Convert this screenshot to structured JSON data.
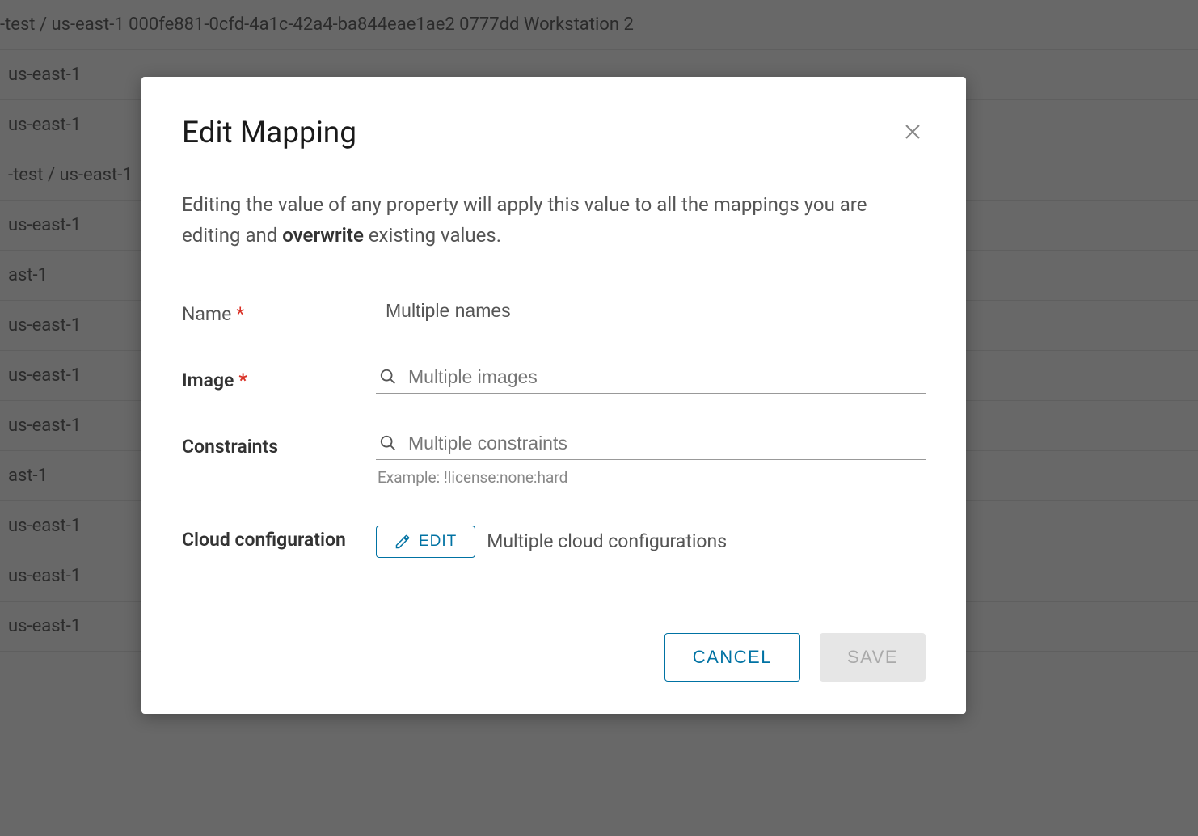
{
  "background": {
    "rows": [
      "-test / us-east-1          000fe881-0cfd-4a1c-42a4-ba844eae1ae2 0777dd Workstation 2",
      "us-east-1",
      "us-east-1",
      "-test / us-east-1",
      "us-east-1",
      "ast-1",
      "us-east-1",
      "us-east-1",
      "us-east-1",
      "ast-1",
      "us-east-1",
      "us-east-1",
      "us-east-1"
    ]
  },
  "modal": {
    "title": "Edit Mapping",
    "description_part1": "Editing the value of any property will apply this value to all the mappings you are editing and ",
    "description_bold": "overwrite",
    "description_part2": " existing values.",
    "fields": {
      "name": {
        "label": "Name",
        "required": true,
        "value": "Multiple names"
      },
      "image": {
        "label": "Image",
        "required": true,
        "placeholder": "Multiple images"
      },
      "constraints": {
        "label": "Constraints",
        "required": false,
        "placeholder": "Multiple constraints",
        "helper": "Example: !license:none:hard"
      },
      "cloud_config": {
        "label": "Cloud configuration",
        "edit_button": "EDIT",
        "value_text": "Multiple cloud configurations"
      }
    },
    "buttons": {
      "cancel": "CANCEL",
      "save": "SAVE"
    }
  }
}
